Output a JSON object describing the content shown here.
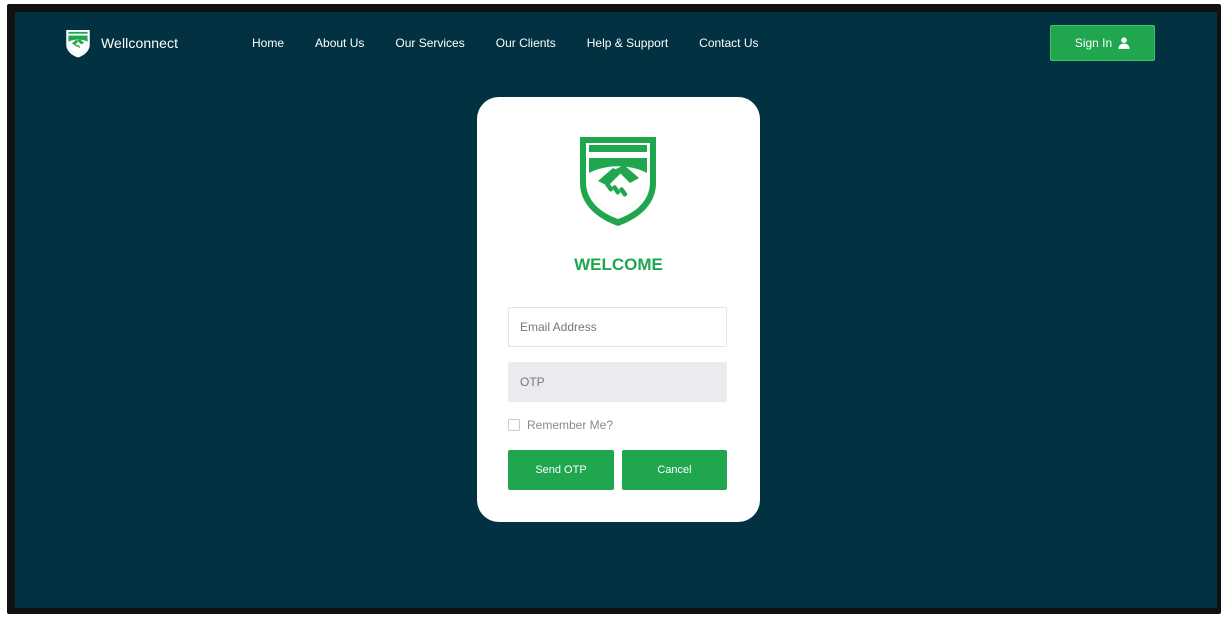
{
  "brand": {
    "name": "Wellconnect",
    "icon": "handshake-shield-icon"
  },
  "nav": {
    "items": [
      {
        "label": "Home"
      },
      {
        "label": "About Us"
      },
      {
        "label": "Our Services"
      },
      {
        "label": "Our Clients"
      },
      {
        "label": "Help & Support"
      },
      {
        "label": "Contact Us"
      }
    ]
  },
  "header": {
    "signin_label": "Sign In",
    "signin_icon": "user-icon"
  },
  "login": {
    "logo_icon": "handshake-shield-icon",
    "welcome": "WELCOME",
    "email_placeholder": "Email Address",
    "otp_placeholder": "OTP",
    "remember_label": "Remember Me?",
    "send_otp_label": "Send OTP",
    "cancel_label": "Cancel"
  },
  "colors": {
    "background": "#023241",
    "accent": "#1fa64e",
    "card": "#ffffff",
    "otp_field": "#e9ebee"
  }
}
